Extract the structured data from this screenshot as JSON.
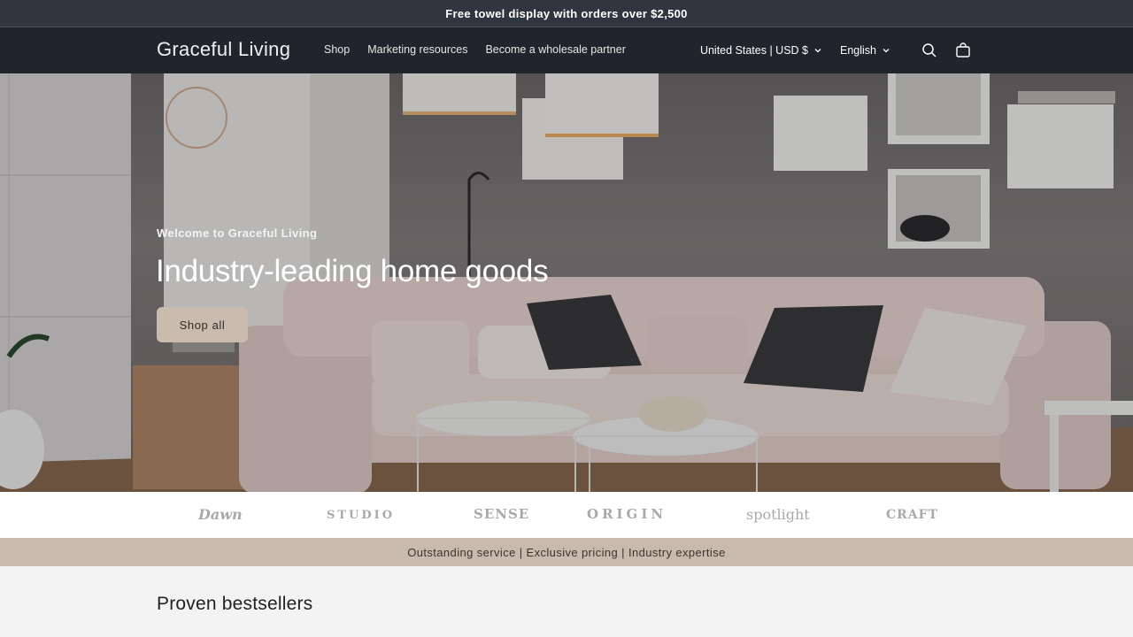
{
  "announcement": "Free towel display with orders over $2,500",
  "header": {
    "logo": "Graceful Living",
    "nav": [
      "Shop",
      "Marketing resources",
      "Become a wholesale partner"
    ],
    "locale": "United States | USD $",
    "language": "English"
  },
  "hero": {
    "subtitle": "Welcome to Graceful Living",
    "title": "Industry-leading home goods",
    "button": "Shop all"
  },
  "brands": [
    "Dawn",
    "STUDIO",
    "SENSE",
    "ORIGIN",
    "spotlight",
    "CRAFT"
  ],
  "tagline": "Outstanding service | Exclusive pricing | Industry expertise",
  "section_title": "Proven bestsellers",
  "colors": {
    "announcement_bg": "#2f3640",
    "header_bg": "#1f252c",
    "button_bg": "#c9bcae",
    "tagline_bg": "#c8bbae"
  }
}
